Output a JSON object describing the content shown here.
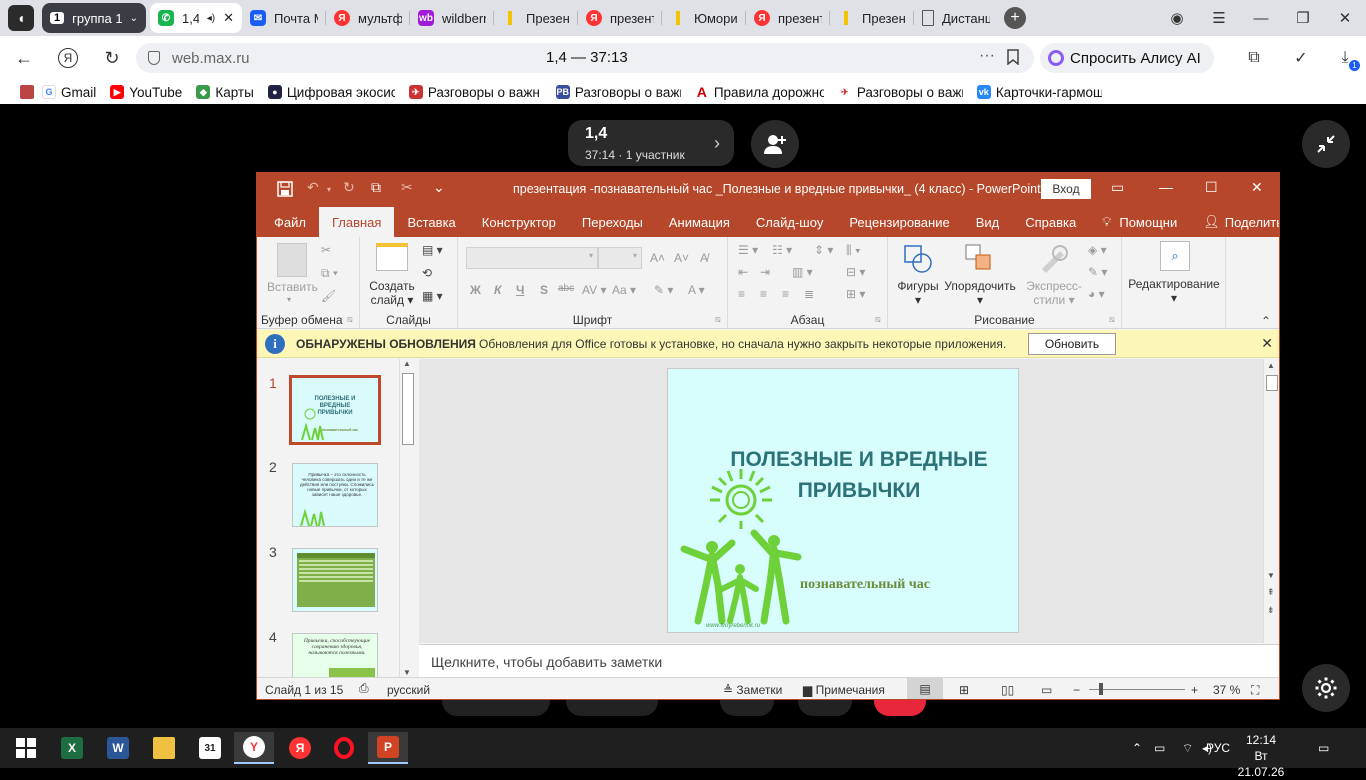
{
  "browser": {
    "tabs": [
      {
        "label": "группа 1",
        "badge": "1"
      },
      {
        "label": "1,4",
        "active": true
      },
      {
        "label": "Почта M"
      },
      {
        "label": "мультф"
      },
      {
        "label": "wildberr"
      },
      {
        "label": "Презент"
      },
      {
        "label": "презент"
      },
      {
        "label": "Юмори"
      },
      {
        "label": "презент"
      },
      {
        "label": "Презен"
      },
      {
        "label": "Дистанц"
      }
    ],
    "url": "web.max.ru",
    "page_title": "1,4 — 37:13",
    "alice_label": "Спросить Алису AI",
    "download_badge": "1",
    "bookmarks": [
      "Gmail",
      "YouTube",
      "Карты",
      "Цифровая экосис",
      "Разговоры о важн",
      "Разговоры о важн",
      "Правила дорожно",
      "Разговоры о важн",
      "Карточки-гармош"
    ]
  },
  "call": {
    "name": "1,4",
    "info": "37:14 · 1 участник"
  },
  "ppt": {
    "title": "презентация -познавательный час _Полезные и вредные привычки_ (4 класс)  -  PowerPoint",
    "login": "Вход",
    "tabs": [
      "Файл",
      "Главная",
      "Вставка",
      "Конструктор",
      "Переходы",
      "Анимация",
      "Слайд-шоу",
      "Рецензирование",
      "Вид",
      "Справка",
      "Помощни",
      "Поделиться"
    ],
    "active_tab": "Главная",
    "ribbon": {
      "paste": "Вставить",
      "clipboard_group": "Буфер обмена",
      "new_slide_1": "Создать",
      "new_slide_2": "слайд",
      "slides_group": "Слайды",
      "font_group": "Шрифт",
      "paragraph_group": "Абзац",
      "shapes": "Фигуры",
      "arrange": "Упорядочить",
      "quick_styles_1": "Экспресс-",
      "quick_styles_2": "стили",
      "drawing_group": "Рисование",
      "editing": "Редактирование"
    },
    "notice": {
      "heading": "ОБНАРУЖЕНЫ ОБНОВЛЕНИЯ",
      "text": "Обновления для Office готовы к установке, но сначала нужно закрыть некоторые приложения.",
      "button": "Обновить"
    },
    "thumbs": [
      {
        "num": "1",
        "title": "ПОЛЕЗНЫЕ И ВРЕДНЫЕ ПРИВЫЧКИ",
        "sub": "познавательный час"
      },
      {
        "num": "2",
        "text": "Привычка – это склонность человека совершать одни и те же действия или поступки. Сложились новые привычки, от которых зависит наше здоровье."
      },
      {
        "num": "3"
      },
      {
        "num": "4",
        "text": "Привычки, способствующие сохранению здоровья, называются полезными."
      }
    ],
    "slide": {
      "title": "ПОЛЕЗНЫЕ И ВРЕДНЫЕ ПРИВЫЧКИ",
      "subtitle": "познавательный час",
      "url": "www.tvoyrebenok.ru"
    },
    "notes_placeholder": "Щелкните, чтобы добавить заметки",
    "status": {
      "slide": "Слайд 1 из 15",
      "language": "русский",
      "notes": "Заметки",
      "comments": "Примечания",
      "zoom": "37 %"
    }
  },
  "taskbar": {
    "language": "РУС",
    "time": "12:14",
    "date": "Вт 21.07.26"
  },
  "colors": {
    "ppt_accent": "#b7472a",
    "slide_bg": "#d7fdfd",
    "slide_title": "#2c7379",
    "figures": "#6fd13a"
  }
}
